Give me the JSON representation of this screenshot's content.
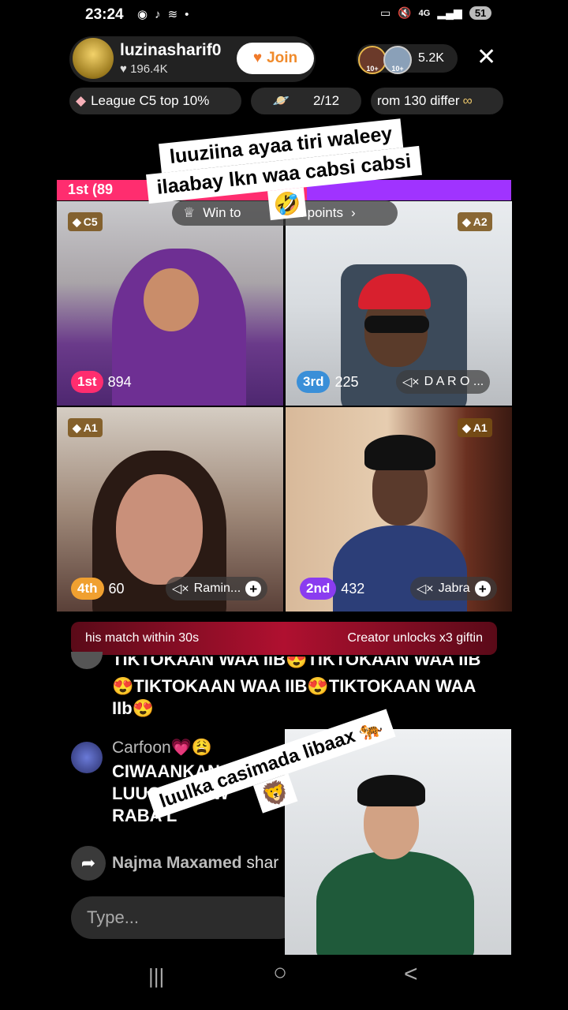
{
  "status_bar": {
    "time": "23:24",
    "network": "4G",
    "battery": "51"
  },
  "host": {
    "name": "luzinasharif0",
    "likes": "196.4K",
    "join_label": "Join"
  },
  "viewers": {
    "count": "5.2K",
    "badge1": "10+",
    "badge2": "10+"
  },
  "chips": {
    "league": "League C5 top 10%",
    "progress": "2/12",
    "ticker": "rom 130 differ"
  },
  "battle": {
    "leader_label": "1st (89"
  },
  "win_chip": {
    "text_a": "Win to",
    "text_b": "2 points"
  },
  "caption": {
    "line1": "luuziina ayaa tiri waleey",
    "line2": "ilaabay lkn waa cabsi cabsi",
    "emoji": "🤣"
  },
  "players": [
    {
      "tier": "C5",
      "rank": "1st",
      "score": "894",
      "rank_color": "#ff2d6f"
    },
    {
      "tier": "A2",
      "rank": "3rd",
      "score": "225",
      "name": "D A R O ...",
      "rank_color": "#3a8fd8"
    },
    {
      "tier": "A1",
      "rank": "4th",
      "score": "60",
      "name": "Ramin...",
      "rank_color": "#f0a030"
    },
    {
      "tier": "A1",
      "rank": "2nd",
      "score": "432",
      "name": "Jabra",
      "rank_color": "#8a3cf0"
    }
  ],
  "banner": {
    "left": "his match within 30s",
    "right": "Creator unlocks x3 giftin"
  },
  "chat": {
    "cut_line": "TIKTOKAAN WAA IIB😍TIKTOKAAN WAA IIB",
    "msg1_line1": "😍TIKTOKAAN WAA IIB😍TIKTOKAAN WAA",
    "msg1_line2": "IIb😍",
    "user2": "Carfoon💗😩",
    "msg2_line1": "CIWAANKAN 66K W",
    "msg2_line2": "LUUQA💙CIW",
    "msg2_line3": "RABA L",
    "joiner": "Najma Maxamed",
    "joiner_suffix": "shar"
  },
  "pip_caption": {
    "line1": "luulka casimada libaax 🐅",
    "line2": "🦁"
  },
  "input": {
    "placeholder": "Type..."
  },
  "nav": {
    "recent": "|||",
    "home": "○",
    "back": "<"
  }
}
